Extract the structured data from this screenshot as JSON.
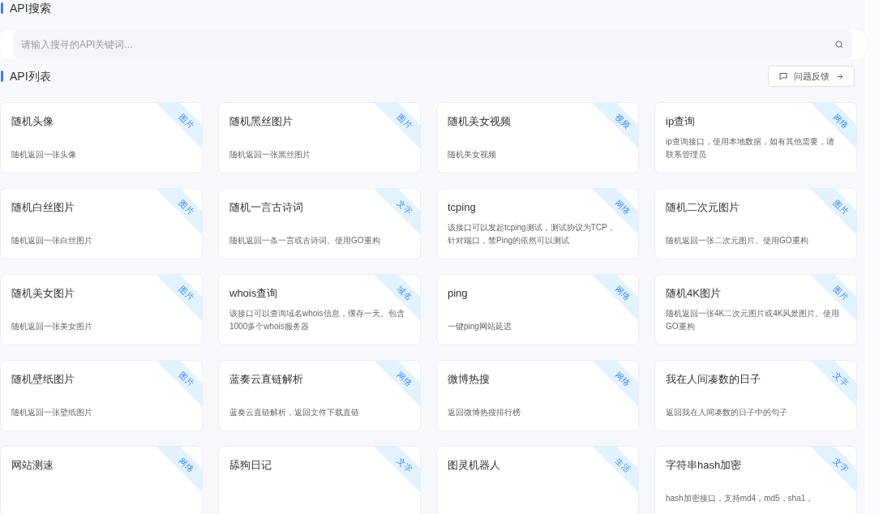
{
  "search_section": {
    "title": "API搜索",
    "search": {
      "placeholder": "请输入搜寻的API关键词..."
    }
  },
  "list_section": {
    "title": "API列表",
    "feedback_button": "问题反馈"
  },
  "apis": [
    {
      "title": "随机头像",
      "description": "随机返回一张头像",
      "tag": "图片"
    },
    {
      "title": "随机黑丝图片",
      "description": "随机返回一张黑丝图片",
      "tag": "图片"
    },
    {
      "title": "随机美女视频",
      "description": "随机美女视频",
      "tag": "视频"
    },
    {
      "title": "ip查询",
      "description": "ip查询接口，使用本地数据，如有其他需要，请联系管理员",
      "tag": "网络"
    },
    {
      "title": "随机白丝图片",
      "description": "随机返回一张白丝图片",
      "tag": "图片"
    },
    {
      "title": "随机一言古诗词",
      "description": "随机返回一条一言或古诗词。使用GO重构",
      "tag": "文字"
    },
    {
      "title": "tcping",
      "description": "该接口可以发起tcping测试，测试协议为TCP，针对端口，禁Ping的依然可以测试",
      "tag": "网络"
    },
    {
      "title": "随机二次元图片",
      "description": "随机返回一张二次元图片。使用GO重构",
      "tag": "图片"
    },
    {
      "title": "随机美女图片",
      "description": "随机返回一张美女图片",
      "tag": "图片"
    },
    {
      "title": "whois查询",
      "description": "该接口可以查询域名whois信息，缓存一天。包含1000多个whois服务器",
      "tag": "域名"
    },
    {
      "title": "ping",
      "description": "一键ping网站延迟",
      "tag": "网络"
    },
    {
      "title": "随机4K图片",
      "description": "随机返回一张4K二次元图片或4K风景图片。使用GO重构",
      "tag": "图片"
    },
    {
      "title": "随机壁纸图片",
      "description": "随机返回一张壁纸图片",
      "tag": "图片"
    },
    {
      "title": "蓝奏云直链解析",
      "description": "蓝奏云直链解析，返回文件下载直链",
      "tag": "网络"
    },
    {
      "title": "微博热搜",
      "description": "返回微博热搜排行榜",
      "tag": "网络"
    },
    {
      "title": "我在人间凑数的日子",
      "description": "返回我在人间凑数的日子中的句子",
      "tag": "文字"
    },
    {
      "title": "网站测速",
      "tag": "网络"
    },
    {
      "title": "舔狗日记",
      "tag": "文字"
    },
    {
      "title": "图灵机器人",
      "tag": "生活"
    },
    {
      "title": "字符串hash加密",
      "description": "hash加密接口，支持md4，md5，sha1，",
      "tag": "文字"
    }
  ]
}
